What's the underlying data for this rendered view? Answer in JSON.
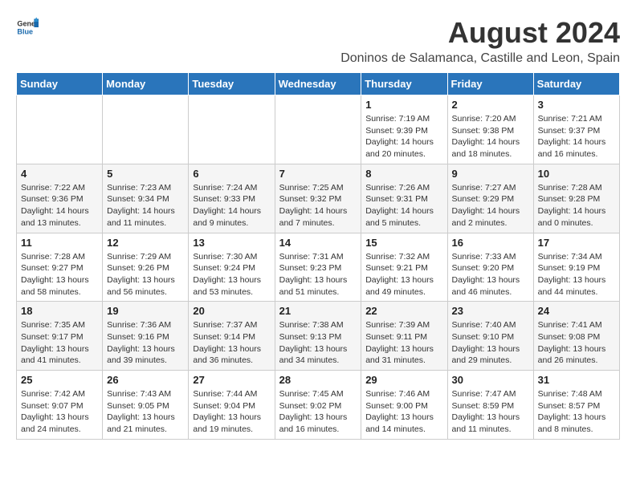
{
  "header": {
    "logo_general": "General",
    "logo_blue": "Blue",
    "month_year": "August 2024",
    "subtitle": "Doninos de Salamanca, Castille and Leon, Spain"
  },
  "weekdays": [
    "Sunday",
    "Monday",
    "Tuesday",
    "Wednesday",
    "Thursday",
    "Friday",
    "Saturday"
  ],
  "weeks": [
    [
      {
        "day": "",
        "info": ""
      },
      {
        "day": "",
        "info": ""
      },
      {
        "day": "",
        "info": ""
      },
      {
        "day": "",
        "info": ""
      },
      {
        "day": "1",
        "info": "Sunrise: 7:19 AM\nSunset: 9:39 PM\nDaylight: 14 hours and 20 minutes."
      },
      {
        "day": "2",
        "info": "Sunrise: 7:20 AM\nSunset: 9:38 PM\nDaylight: 14 hours and 18 minutes."
      },
      {
        "day": "3",
        "info": "Sunrise: 7:21 AM\nSunset: 9:37 PM\nDaylight: 14 hours and 16 minutes."
      }
    ],
    [
      {
        "day": "4",
        "info": "Sunrise: 7:22 AM\nSunset: 9:36 PM\nDaylight: 14 hours and 13 minutes."
      },
      {
        "day": "5",
        "info": "Sunrise: 7:23 AM\nSunset: 9:34 PM\nDaylight: 14 hours and 11 minutes."
      },
      {
        "day": "6",
        "info": "Sunrise: 7:24 AM\nSunset: 9:33 PM\nDaylight: 14 hours and 9 minutes."
      },
      {
        "day": "7",
        "info": "Sunrise: 7:25 AM\nSunset: 9:32 PM\nDaylight: 14 hours and 7 minutes."
      },
      {
        "day": "8",
        "info": "Sunrise: 7:26 AM\nSunset: 9:31 PM\nDaylight: 14 hours and 5 minutes."
      },
      {
        "day": "9",
        "info": "Sunrise: 7:27 AM\nSunset: 9:29 PM\nDaylight: 14 hours and 2 minutes."
      },
      {
        "day": "10",
        "info": "Sunrise: 7:28 AM\nSunset: 9:28 PM\nDaylight: 14 hours and 0 minutes."
      }
    ],
    [
      {
        "day": "11",
        "info": "Sunrise: 7:28 AM\nSunset: 9:27 PM\nDaylight: 13 hours and 58 minutes."
      },
      {
        "day": "12",
        "info": "Sunrise: 7:29 AM\nSunset: 9:26 PM\nDaylight: 13 hours and 56 minutes."
      },
      {
        "day": "13",
        "info": "Sunrise: 7:30 AM\nSunset: 9:24 PM\nDaylight: 13 hours and 53 minutes."
      },
      {
        "day": "14",
        "info": "Sunrise: 7:31 AM\nSunset: 9:23 PM\nDaylight: 13 hours and 51 minutes."
      },
      {
        "day": "15",
        "info": "Sunrise: 7:32 AM\nSunset: 9:21 PM\nDaylight: 13 hours and 49 minutes."
      },
      {
        "day": "16",
        "info": "Sunrise: 7:33 AM\nSunset: 9:20 PM\nDaylight: 13 hours and 46 minutes."
      },
      {
        "day": "17",
        "info": "Sunrise: 7:34 AM\nSunset: 9:19 PM\nDaylight: 13 hours and 44 minutes."
      }
    ],
    [
      {
        "day": "18",
        "info": "Sunrise: 7:35 AM\nSunset: 9:17 PM\nDaylight: 13 hours and 41 minutes."
      },
      {
        "day": "19",
        "info": "Sunrise: 7:36 AM\nSunset: 9:16 PM\nDaylight: 13 hours and 39 minutes."
      },
      {
        "day": "20",
        "info": "Sunrise: 7:37 AM\nSunset: 9:14 PM\nDaylight: 13 hours and 36 minutes."
      },
      {
        "day": "21",
        "info": "Sunrise: 7:38 AM\nSunset: 9:13 PM\nDaylight: 13 hours and 34 minutes."
      },
      {
        "day": "22",
        "info": "Sunrise: 7:39 AM\nSunset: 9:11 PM\nDaylight: 13 hours and 31 minutes."
      },
      {
        "day": "23",
        "info": "Sunrise: 7:40 AM\nSunset: 9:10 PM\nDaylight: 13 hours and 29 minutes."
      },
      {
        "day": "24",
        "info": "Sunrise: 7:41 AM\nSunset: 9:08 PM\nDaylight: 13 hours and 26 minutes."
      }
    ],
    [
      {
        "day": "25",
        "info": "Sunrise: 7:42 AM\nSunset: 9:07 PM\nDaylight: 13 hours and 24 minutes."
      },
      {
        "day": "26",
        "info": "Sunrise: 7:43 AM\nSunset: 9:05 PM\nDaylight: 13 hours and 21 minutes."
      },
      {
        "day": "27",
        "info": "Sunrise: 7:44 AM\nSunset: 9:04 PM\nDaylight: 13 hours and 19 minutes."
      },
      {
        "day": "28",
        "info": "Sunrise: 7:45 AM\nSunset: 9:02 PM\nDaylight: 13 hours and 16 minutes."
      },
      {
        "day": "29",
        "info": "Sunrise: 7:46 AM\nSunset: 9:00 PM\nDaylight: 13 hours and 14 minutes."
      },
      {
        "day": "30",
        "info": "Sunrise: 7:47 AM\nSunset: 8:59 PM\nDaylight: 13 hours and 11 minutes."
      },
      {
        "day": "31",
        "info": "Sunrise: 7:48 AM\nSunset: 8:57 PM\nDaylight: 13 hours and 8 minutes."
      }
    ]
  ]
}
